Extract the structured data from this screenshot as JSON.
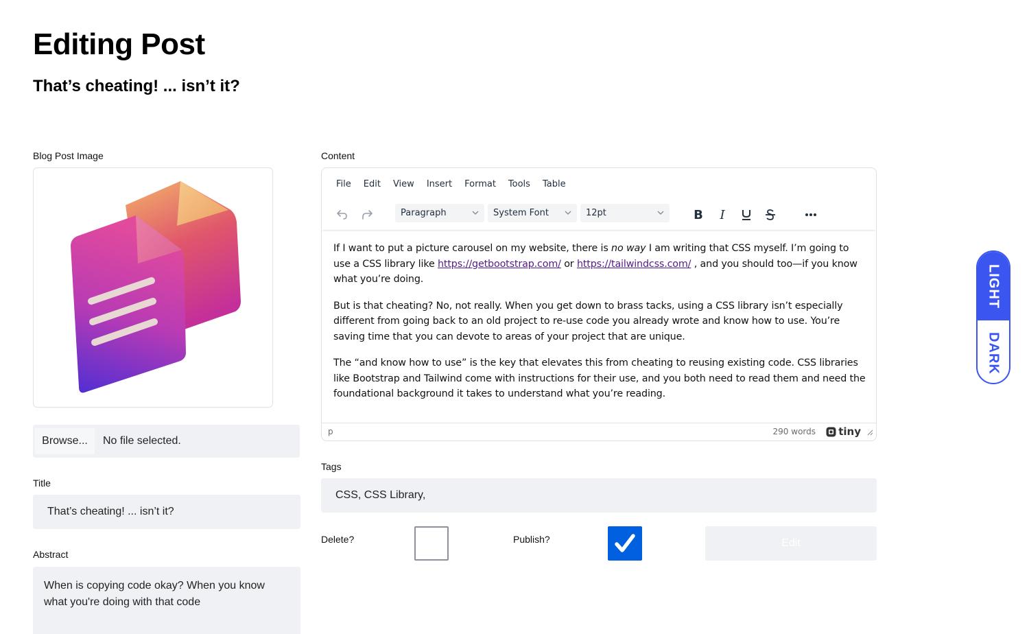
{
  "header": {
    "title": "Editing Post",
    "subtitle": "That’s cheating! ... isn’t it?"
  },
  "image_section": {
    "label": "Blog Post Image",
    "image_alt": "documents-icon",
    "browse_label": "Browse...",
    "file_status": "No file selected."
  },
  "title_field": {
    "label": "Title",
    "value": "That’s cheating! ... isn’t it?"
  },
  "abstract_field": {
    "label": "Abstract",
    "value": "When is copying code okay? When you know what you're doing with that code"
  },
  "content": {
    "label": "Content",
    "menu": [
      "File",
      "Edit",
      "View",
      "Insert",
      "Format",
      "Tools",
      "Table"
    ],
    "toolbar": {
      "block_format": "Paragraph",
      "font_family": "System Font",
      "font_size": "12pt",
      "icons": [
        "undo-icon",
        "redo-icon",
        "bold-icon",
        "italic-icon",
        "underline-icon",
        "strikethrough-icon",
        "more-icon"
      ]
    },
    "paragraphs": {
      "p1_a": "If I want to put a picture carousel on my website, there is ",
      "p1_em": "no way",
      "p1_b": " I am writing that CSS myself. I’m going to use a CSS library like ",
      "p1_link1": "https://getbootstrap.com/",
      "p1_c": " or ",
      "p1_link2": "https://tailwindcss.com/",
      "p1_d": " , and you should too—if you know what you’re doing.",
      "p2": "But is that cheating? No, not really. When you get down to brass tacks, using a CSS library isn’t especially different from going back to an old project to re-use code you already wrote and know how to use. You’re saving time that you can devote to areas of your project that are unique.",
      "p3": "The “and know how to use” is the key that elevates this from cheating to reusing existing code. CSS libraries like Bootstrap and Tailwind come with instructions for their use, and you both need to read them and need the foundational background it takes to understand what you’re reading."
    },
    "status": {
      "path": "p",
      "word_count": "290 words",
      "brand": "tiny"
    }
  },
  "tags_field": {
    "label": "Tags",
    "value": "CSS, CSS Library,"
  },
  "delete_field": {
    "label": "Delete?",
    "checked": false
  },
  "publish_field": {
    "label": "Publish?",
    "checked": true
  },
  "edit_button": {
    "label": "Edit"
  },
  "theme_toggle": {
    "light_label": "LIGHT",
    "dark_label": "DARK",
    "active": "LIGHT",
    "accent": "#3b55f0"
  },
  "colors": {
    "input_bg": "#f0f1f5",
    "checkbox_checked": "#0060df",
    "link": "#551a8b"
  }
}
